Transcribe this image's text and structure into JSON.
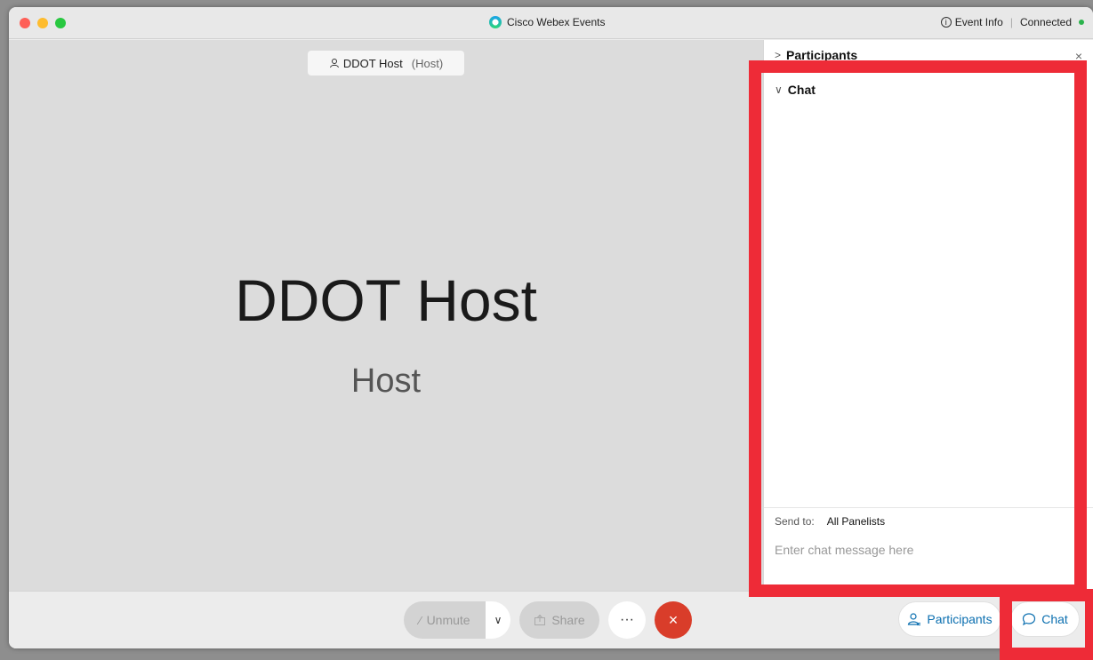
{
  "window": {
    "app_title": "Cisco Webex Events",
    "event_info_label": "Event Info",
    "connection_status": "Connected"
  },
  "stage": {
    "pill_name": "DDOT Host",
    "pill_role": "(Host)",
    "big_name": "DDOT Host",
    "big_role": "Host"
  },
  "panel": {
    "participants_title": "Participants",
    "chat_title": "Chat",
    "send_to_label": "Send to:",
    "send_to_value": "All Panelists",
    "chat_placeholder": "Enter chat message here"
  },
  "controls": {
    "unmute_label": "Unmute",
    "share_label": "Share",
    "more_label": "···",
    "leave_label": "×",
    "participants_button": "Participants",
    "chat_button": "Chat"
  },
  "colors": {
    "highlight": "#ee2b37",
    "leave": "#d93d2a",
    "accent": "#0b6fb0",
    "connected": "#2bb34c"
  },
  "icons": {
    "app_logo": "webex-logo-icon",
    "info": "info-icon",
    "host": "host-icon",
    "microphone": "microphone-muted-icon",
    "share": "share-icon",
    "participants": "participants-icon",
    "chat": "chat-bubble-icon"
  }
}
